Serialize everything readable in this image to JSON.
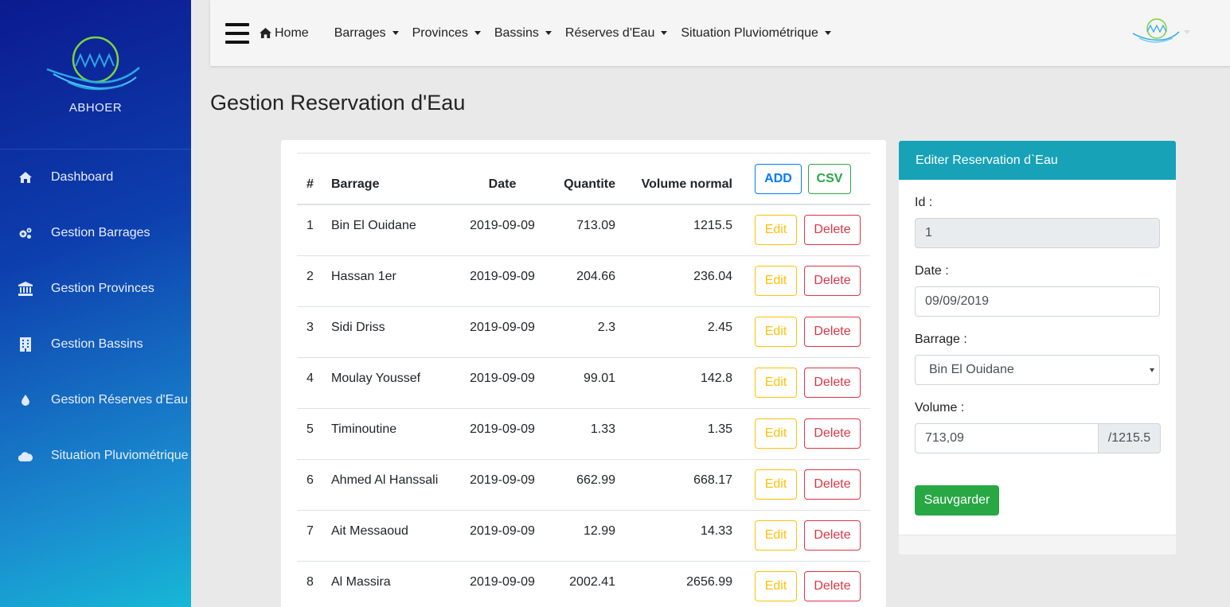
{
  "sidebar": {
    "logo_text": "ABHOER",
    "items": [
      {
        "label": "Dashboard",
        "icon": "home-icon"
      },
      {
        "label": "Gestion Barrages",
        "icon": "gears-icon"
      },
      {
        "label": "Gestion Provinces",
        "icon": "bank-icon"
      },
      {
        "label": "Gestion Bassins",
        "icon": "building-icon"
      },
      {
        "label": "Gestion Réserves d'Eau",
        "icon": "water-drop-icon"
      },
      {
        "label": "Situation Pluviométrique",
        "icon": "cloud-icon"
      }
    ]
  },
  "topnav": {
    "home": "Home",
    "menus": [
      "Barrages",
      "Provinces",
      "Bassins",
      "Réserves d'Eau",
      "Situation Pluviométrique"
    ]
  },
  "page": {
    "title": "Gestion Reservation d'Eau"
  },
  "table": {
    "headers": {
      "num": "#",
      "barrage": "Barrage",
      "date": "Date",
      "quantite": "Quantite",
      "volume": "Volume normal"
    },
    "add_label": "ADD",
    "csv_label": "CSV",
    "edit_label": "Edit",
    "delete_label": "Delete",
    "rows": [
      {
        "num": "1",
        "barrage": "Bin El Ouidane",
        "date": "2019-09-09",
        "quantite": "713.09",
        "volume": "1215.5"
      },
      {
        "num": "2",
        "barrage": "Hassan 1er",
        "date": "2019-09-09",
        "quantite": "204.66",
        "volume": "236.04"
      },
      {
        "num": "3",
        "barrage": "Sidi Driss",
        "date": "2019-09-09",
        "quantite": "2.3",
        "volume": "2.45"
      },
      {
        "num": "4",
        "barrage": "Moulay Youssef",
        "date": "2019-09-09",
        "quantite": "99.01",
        "volume": "142.8"
      },
      {
        "num": "5",
        "barrage": "Timinoutine",
        "date": "2019-09-09",
        "quantite": "1.33",
        "volume": "1.35"
      },
      {
        "num": "6",
        "barrage": "Ahmed Al Hanssali",
        "date": "2019-09-09",
        "quantite": "662.99",
        "volume": "668.17"
      },
      {
        "num": "7",
        "barrage": "Ait Messaoud",
        "date": "2019-09-09",
        "quantite": "12.99",
        "volume": "14.33"
      },
      {
        "num": "8",
        "barrage": "Al Massira",
        "date": "2019-09-09",
        "quantite": "2002.41",
        "volume": "2656.99"
      }
    ]
  },
  "edit_form": {
    "title": "Editer Reservation d`Eau",
    "id_label": "Id :",
    "id_value": "1",
    "date_label": "Date :",
    "date_value": "09/09/2019",
    "barrage_label": "Barrage :",
    "barrage_value": "Bin El Ouidane",
    "volume_label": "Volume :",
    "volume_value": "713,09",
    "volume_addon": "/1215.5",
    "save_label": "Sauvgarder"
  },
  "colors": {
    "sidebar_gradient_start": "#0b1a8f",
    "sidebar_gradient_end": "#17b7d6",
    "card_header": "#17a2b8",
    "add": "#007bff",
    "csv": "#28a745",
    "edit": "#ffc107",
    "delete": "#dc3545",
    "save": "#28a745"
  }
}
